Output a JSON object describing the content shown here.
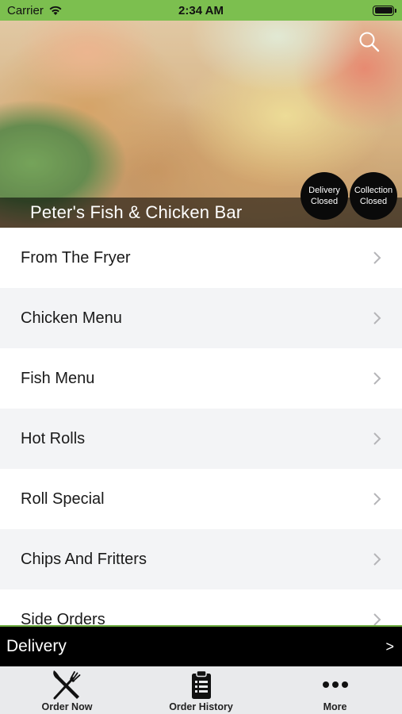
{
  "status_bar": {
    "carrier": "Carrier",
    "time": "2:34 AM"
  },
  "hero": {
    "restaurant_name": "Peter's Fish & Chicken Bar",
    "delivery_status": {
      "line1": "Delivery",
      "line2": "Closed"
    },
    "collection_status": {
      "line1": "Collection",
      "line2": "Closed"
    }
  },
  "menu": {
    "items": [
      {
        "label": "From The Fryer"
      },
      {
        "label": "Chicken Menu"
      },
      {
        "label": "Fish Menu"
      },
      {
        "label": "Hot Rolls"
      },
      {
        "label": "Roll Special"
      },
      {
        "label": "Chips And Fritters"
      },
      {
        "label": "Side Orders"
      }
    ]
  },
  "order_mode": {
    "label": "Delivery",
    "arrow": ">"
  },
  "tab_bar": {
    "tabs": [
      {
        "label": "Order Now",
        "icon": "fork-knife-icon"
      },
      {
        "label": "Order History",
        "icon": "clipboard-icon"
      },
      {
        "label": "More",
        "icon": "more-dots-icon"
      }
    ]
  },
  "colors": {
    "brand_green": "#7cbf4f",
    "bar_black": "#000000",
    "tab_bar_bg": "#e9eaec"
  }
}
